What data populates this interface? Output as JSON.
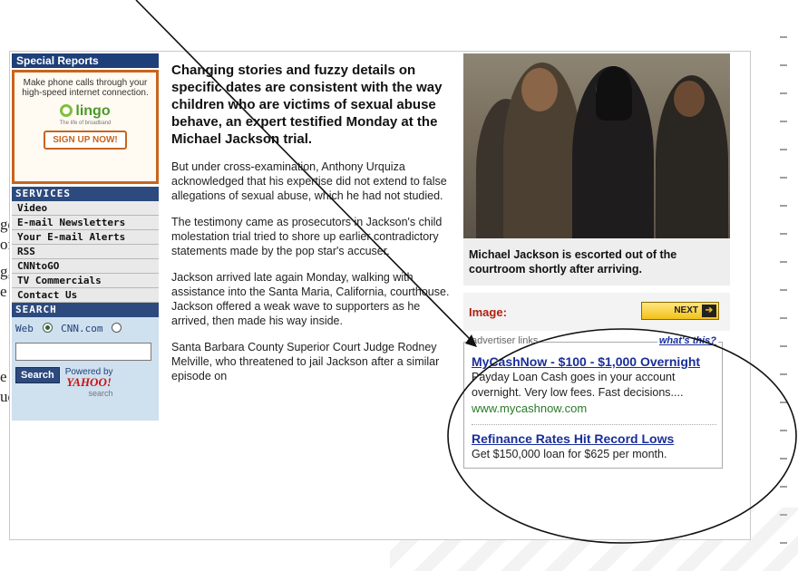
{
  "background_fragments": [
    "ge",
    "of",
    "g,",
    "e",
    "e",
    "ue"
  ],
  "sidebar": {
    "special_reports": "Special Reports",
    "ad": {
      "text": "Make phone calls through your high-speed internet connection.",
      "brand": "lingo",
      "tagline": "The life of broadband",
      "cta": "SIGN UP NOW!"
    },
    "services_header": "SERVICES",
    "services": [
      "Video",
      "E-mail Newsletters",
      "Your E-mail Alerts",
      "RSS",
      "CNNtoGO",
      "TV Commercials",
      "Contact Us"
    ],
    "search_header": "SEARCH",
    "search": {
      "option_web": "Web",
      "option_cnn": "CNN.com",
      "input_value": "",
      "button": "Search",
      "powered_by": "Powered by",
      "provider": "YAHOO!",
      "provider_sub": "search"
    }
  },
  "article": {
    "headline": "Changing stories and fuzzy details on specific dates are consistent with the way children who are victims of sexual abuse behave, an expert testified Monday at the Michael Jackson trial.",
    "paragraphs": [
      "But under cross-examination, Anthony Urquiza acknowledged that his expertise did not extend to false allegations of sexual abuse, which he had not studied.",
      "The testimony came as prosecutors in Jackson's child molestation trial tried to shore up earlier contradictory statements made by the pop star's accuser.",
      "Jackson arrived late again Monday, walking with assistance into the Santa Maria, California, courthouse. Jackson offered a weak wave to supporters as he arrived, then made his way inside.",
      "Santa Barbara County Superior Court Judge Rodney Melville, who threatened to jail Jackson after a similar episode on"
    ]
  },
  "photo": {
    "caption": "Michael Jackson is escorted out of the courtroom shortly after arriving.",
    "image_label": "Image:",
    "next": "NEXT"
  },
  "advertiser": {
    "legend": "advertiser links",
    "whats_this": "what's this?",
    "ads": [
      {
        "title": "MyCashNow - $100 - $1,000 Overnight",
        "desc": "Payday Loan Cash goes in your account overnight. Very low fees. Fast decisions....",
        "url": "www.mycashnow.com"
      },
      {
        "title": "Refinance Rates Hit Record Lows",
        "desc": "Get $150,000 loan for $625 per month."
      }
    ]
  },
  "colors": {
    "nav_blue": "#2c4a7e",
    "ad_orange": "#c8641e",
    "link_blue": "#1a2f9a",
    "url_green": "#2a7a2a",
    "image_red": "#b02010"
  }
}
